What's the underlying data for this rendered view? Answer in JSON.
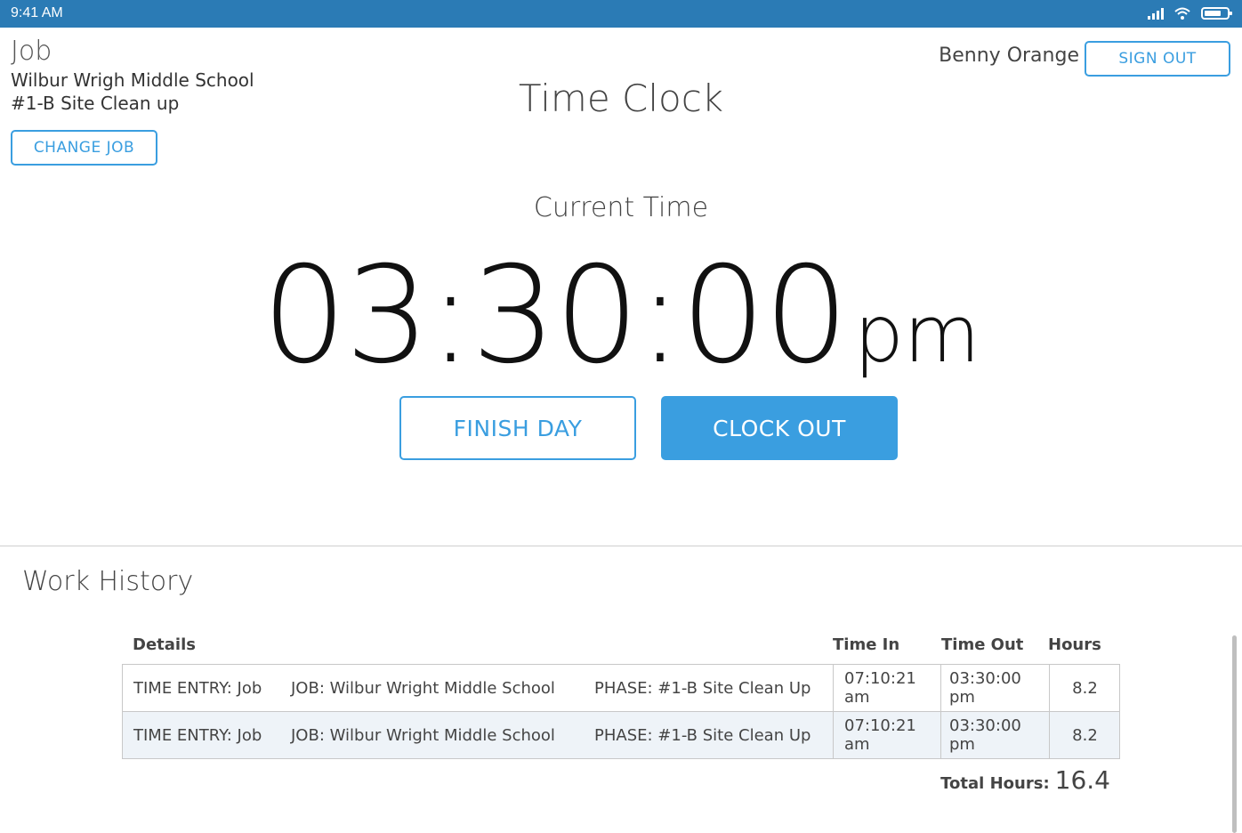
{
  "status_bar": {
    "time": "9:41 AM"
  },
  "job": {
    "label": "Job",
    "name": "Wilbur Wrigh Middle School",
    "phase": "#1-B Site Clean up",
    "change_job_label": "CHANGE JOB"
  },
  "user": {
    "name": "Benny Orange",
    "sign_out_label": "SIGN OUT"
  },
  "main": {
    "title": "Time Clock",
    "current_time_label": "Current Time",
    "clock_time": "03:30:00",
    "clock_ampm": "pm",
    "finish_day_label": "FINISH DAY",
    "clock_out_label": "CLOCK OUT"
  },
  "history": {
    "title": "Work History",
    "columns": {
      "details": "Details",
      "time_in": "Time In",
      "time_out": "Time Out",
      "hours": "Hours"
    },
    "rows": [
      {
        "entry": "TIME ENTRY: Job",
        "job": "JOB: Wilbur Wright Middle School",
        "phase": "PHASE: #1-B Site Clean Up",
        "time_in": "07:10:21 am",
        "time_out": "03:30:00 pm",
        "hours": "8.2"
      },
      {
        "entry": "TIME ENTRY: Job",
        "job": "JOB: Wilbur Wright Middle School",
        "phase": "PHASE: #1-B Site Clean Up",
        "time_in": "07:10:21 am",
        "time_out": "03:30:00 pm",
        "hours": "8.2"
      }
    ],
    "total_label": "Total Hours:",
    "total_value": "16.4"
  },
  "colors": {
    "status_bar": "#2b7bb5",
    "accent": "#3a9ee0"
  },
  "icons": [
    "signal-icon",
    "wifi-icon",
    "battery-icon"
  ]
}
